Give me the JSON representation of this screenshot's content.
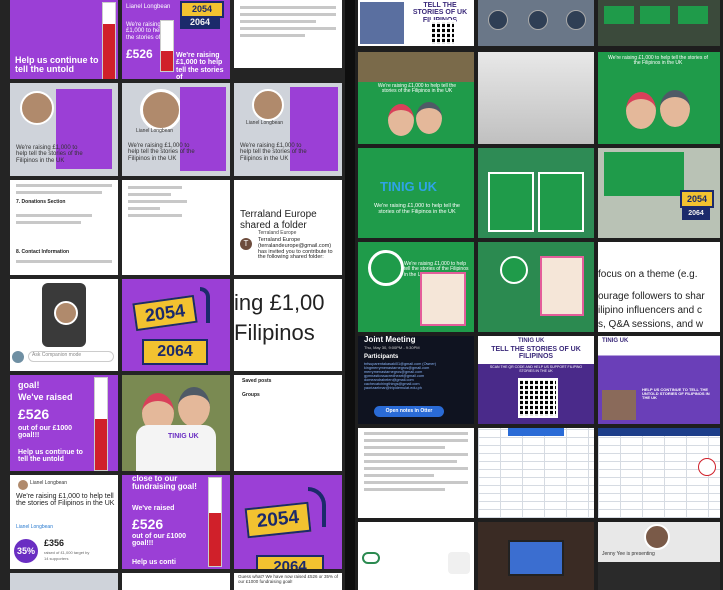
{
  "colors": {
    "purple": "#9b3fd6",
    "deep_purple": "#5a2b8f",
    "red": "#d0202a",
    "green": "#1f9b4a",
    "navy": "#1b2a6b",
    "yellow": "#f2c230"
  },
  "left": {
    "r1": {
      "c1": {
        "text": "Help us continue to tell the untold"
      },
      "c2": {
        "name": "Lianel Longbean",
        "numbers": [
          "2054",
          "2064"
        ],
        "raising": "We're raising £1,000 to help the stories of",
        "amount": "£526",
        "goal": "We're raising £1,000 to help tell the stories of"
      },
      "c3": {
        "icon": "document-icon"
      }
    },
    "r2": {
      "c1": {
        "raising": "We're raising £1,000 to help tell the stories of the Filipinos in the UK"
      },
      "c2": {
        "name": "Lianel Longbean",
        "raising": "We're raising £1,000 to help tell the stories of the Filipinos in the UK"
      },
      "c3": {
        "name": "Lianel Longbean",
        "raising": "We're raising £1,000 to help tell the stories of the Filipinos in the UK"
      }
    },
    "r3": {
      "c1": {
        "heading": "7. Donations Section",
        "footer": "8. Contact Information"
      },
      "c3": {
        "sender": "Terraland Europe",
        "title": "Terraland Europe shared a folder",
        "avatar_letter": "T",
        "body": "Terraland Europe (terralandeurope@gmail.com) has invited you to contribute to the following shared folder:"
      }
    },
    "r4": {
      "c1": {
        "input_placeholder": "Ask Companion mode"
      },
      "c2": {
        "numbers": [
          "2054",
          "2064"
        ]
      },
      "c3": {
        "line1": "ing £1,00",
        "line2": "Filipinos"
      }
    },
    "r5": {
      "c1": {
        "goal": "goal!",
        "raised": "We've raised",
        "amount": "£526",
        "out_of": "out of our £1000 goal!!!",
        "help": "Help us continue to tell the untold"
      },
      "c2": {
        "tshirt": "TINIG UK"
      },
      "c3": {
        "saved": "Saved posts",
        "groups": "Groups"
      }
    },
    "r6": {
      "c1": {
        "name": "Lianel Longbean",
        "raising": "We're raising £1,000 to help tell the stories of Filipinos in the UK",
        "organised": "Lianel Longbean",
        "amount": "£356",
        "raised_of": "raised of £1,000 target by",
        "supporters": "14 supporters",
        "percent": "35%"
      },
      "c2": {
        "close": "close to our fundraising goal!",
        "raised": "We've raised",
        "amount": "£526",
        "out_of": "out of our £1000 goal!!!",
        "help": "Help us conti"
      },
      "c3": {
        "numbers": [
          "2054",
          "2064"
        ]
      }
    },
    "r7": {
      "c3": {
        "text": "Guess what? We have now raised £526 or 35% of our £1000 fundraising goal!"
      }
    }
  },
  "right": {
    "r1": {
      "c1": {
        "title": "TELL THE STORIES OF UK FILIPINOS"
      }
    },
    "r2": {
      "c1": {
        "raising": "We're raising £1,000 to help tell the stories of the Filipinos in the UK"
      },
      "c3": {
        "raising": "We're raising £1,000 to help tell the stories of the Filipinos in the UK"
      }
    },
    "r3": {
      "c1": {
        "logo": "TINIG UK",
        "raising": "We're raising £1,000 to help tell the stories of the Filipinos in the UK"
      },
      "c3": {
        "numbers": [
          "2054",
          "2064"
        ]
      }
    },
    "r4": {
      "c1": {
        "raising": "We're raising £1,000 to help tell the stories of the Filipinos in the UK"
      },
      "c3": {
        "line1": "focus on a theme (e.g.",
        "line2": "ourage followers to shar",
        "line3": "ilipino influencers and c",
        "line4": "s, Q&A sessions, and w"
      }
    },
    "r5": {
      "c1": {
        "title": "Joint Meeting",
        "date": "Thu, May 30, 9:00PM - 9:30PM",
        "participants": "Participants",
        "emails": [
          "tnfsuparentakasaki01@gmail.com (Owner)",
          "kingmerrymenastarnegros@gmail.com",
          "merrymenastarnegros@gmail.com",
          "gymnasticssacredheart@gmail.com",
          "domeandrabelen@gmail.com",
          "cachecatchingthings@gmail.com",
          "yaorizaelmar@tripidemulat.edu.ph"
        ],
        "button": "Open notes in Otter"
      },
      "c2": {
        "logo": "TINIG UK",
        "title": "TELL THE STORIES OF UK FILIPINOS",
        "scan": "SCAN THE QR CODE AND HELP US SUPPORT FILIPINO STORIES IN THE UK"
      },
      "c3": {
        "logo": "TINIG UK",
        "help": "HELP US CONTINUE TO TELL THE UNTOLD STORIES OF FILIPINOS IN THE UK"
      }
    },
    "r7": {
      "c3": {
        "presenting": "Jenny Yee is presenting"
      }
    }
  }
}
